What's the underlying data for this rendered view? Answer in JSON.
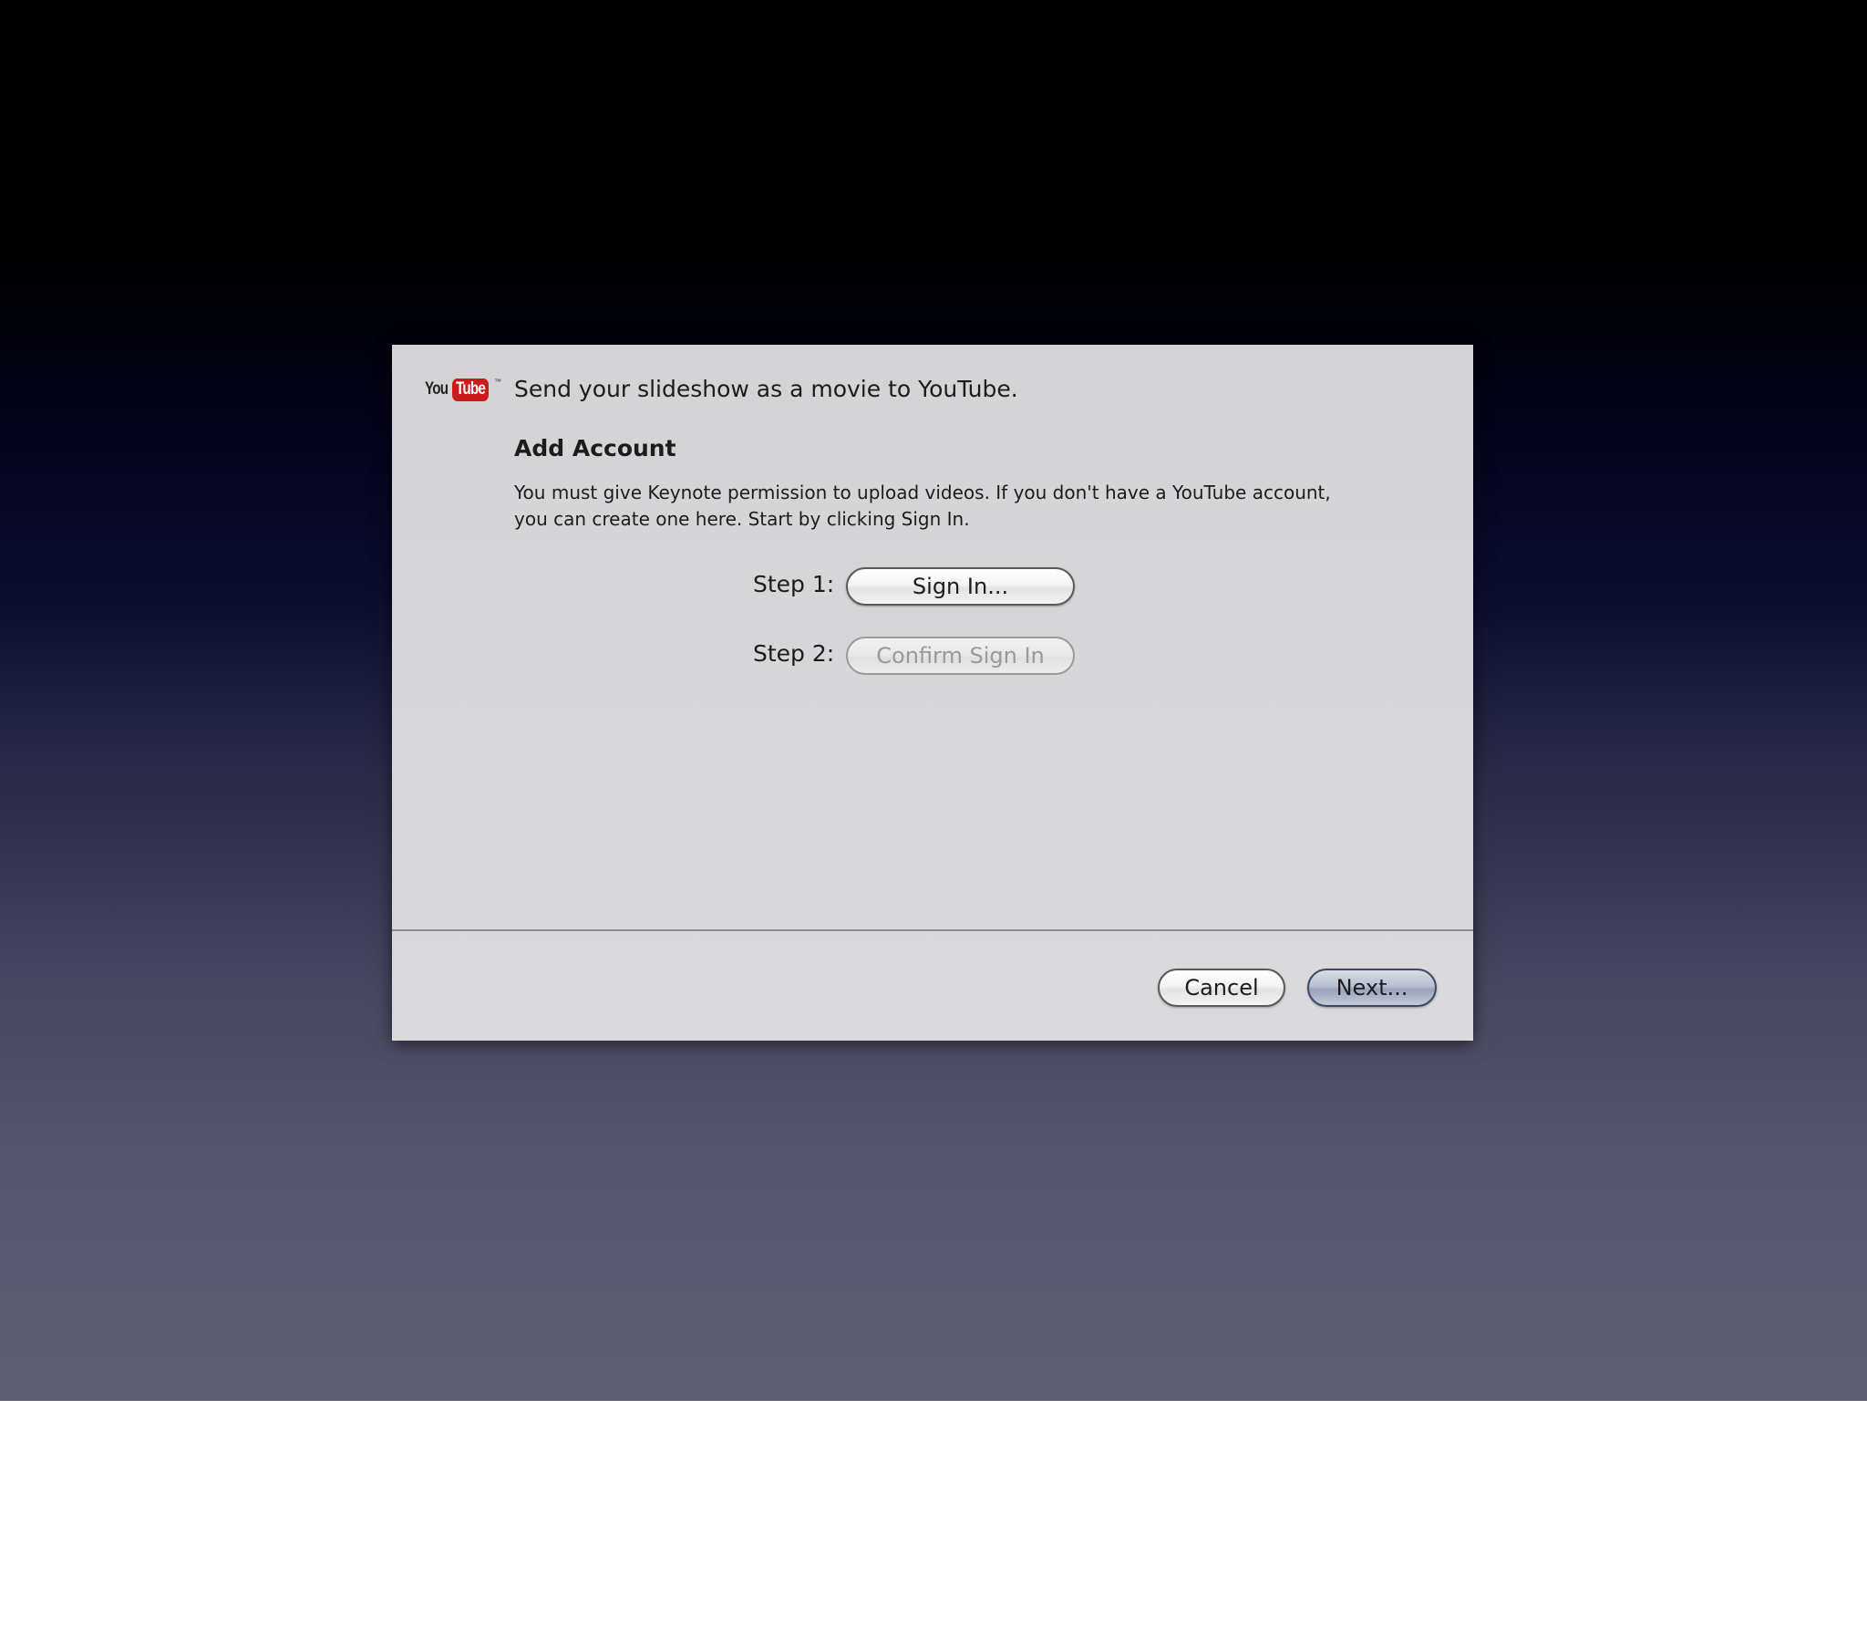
{
  "dialog": {
    "logo": {
      "you": "You",
      "tube": "Tube",
      "tm": "™"
    },
    "title": "Send your slideshow as a movie to YouTube.",
    "section_title": "Add Account",
    "description": "You must give Keynote permission to upload videos. If you don't have a YouTube account, you can create one here. Start by clicking Sign In.",
    "steps": [
      {
        "label": "Step 1:",
        "button": "Sign In...",
        "enabled": true
      },
      {
        "label": "Step 2:",
        "button": "Confirm Sign In",
        "enabled": false
      }
    ],
    "footer": {
      "cancel_label": "Cancel",
      "next_label": "Next..."
    }
  },
  "colors": {
    "youtube_red": "#cc1b1b",
    "dialog_bg": "#d6d6d9",
    "default_button": "#9aa4ba"
  }
}
